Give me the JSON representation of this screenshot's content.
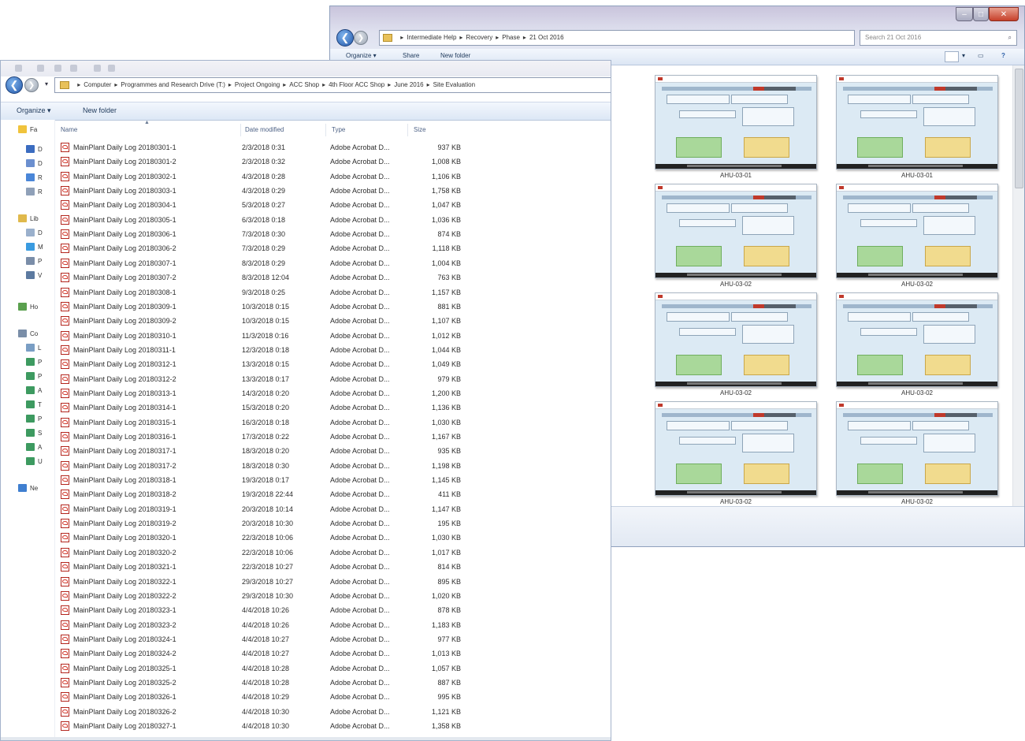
{
  "back_window": {
    "address_crumbs": [
      "▸",
      "Intermediate Help",
      "▸",
      "Recovery",
      "▸",
      "Phase",
      "▸",
      "21 Oct 2016"
    ],
    "search_placeholder": "Search 21 Oct 2016",
    "toolbar": {
      "organize": "Organize ▾",
      "share": "Share",
      "new_folder": "New folder"
    },
    "thumbnails": [
      {
        "caption": "AHU-03-01"
      },
      {
        "caption": "AHU-03-01"
      },
      {
        "caption": "AHU-03-02"
      },
      {
        "caption": "AHU-03-02"
      },
      {
        "caption": "AHU-03-02"
      },
      {
        "caption": "AHU-03-02"
      },
      {
        "caption": "AHU-03-02"
      },
      {
        "caption": "AHU-03-02"
      }
    ]
  },
  "front_window": {
    "address_crumbs": [
      "▸",
      "Computer",
      "▸",
      "Programmes and Research Drive (T:)",
      "▸",
      "Project Ongoing",
      "▸",
      "ACC Shop",
      "▸",
      "4th Floor ACC Shop",
      "▸",
      "June 2016",
      "▸",
      "Site Evaluation"
    ],
    "toolbar": {
      "organize": "Organize ▾",
      "new_folder": "New folder"
    },
    "nav_items": [
      {
        "label": "Fa"
      },
      {
        "label": "D"
      },
      {
        "label": "D"
      },
      {
        "label": "R"
      },
      {
        "label": "R"
      },
      {
        "label": "Lib"
      },
      {
        "label": "D"
      },
      {
        "label": "M"
      },
      {
        "label": "P"
      },
      {
        "label": "V"
      },
      {
        "label": "Ho"
      },
      {
        "label": "Co"
      },
      {
        "label": "L"
      },
      {
        "label": "P"
      },
      {
        "label": "P"
      },
      {
        "label": "A"
      },
      {
        "label": "T"
      },
      {
        "label": "P"
      },
      {
        "label": "S"
      },
      {
        "label": "A"
      },
      {
        "label": "U"
      },
      {
        "label": "Ne"
      }
    ],
    "columns": {
      "name": "Name",
      "date": "Date modified",
      "type": "Type",
      "size": "Size"
    },
    "files": [
      {
        "name": "MainPlant Daily Log 20180301-1",
        "date": "2/3/2018 0:31",
        "type": "Adobe Acrobat D...",
        "size": "937 KB"
      },
      {
        "name": "MainPlant Daily Log 20180301-2",
        "date": "2/3/2018 0:32",
        "type": "Adobe Acrobat D...",
        "size": "1,008 KB"
      },
      {
        "name": "MainPlant Daily Log 20180302-1",
        "date": "4/3/2018 0:28",
        "type": "Adobe Acrobat D...",
        "size": "1,106 KB"
      },
      {
        "name": "MainPlant Daily Log 20180303-1",
        "date": "4/3/2018 0:29",
        "type": "Adobe Acrobat D...",
        "size": "1,758 KB"
      },
      {
        "name": "MainPlant Daily Log 20180304-1",
        "date": "5/3/2018 0:27",
        "type": "Adobe Acrobat D...",
        "size": "1,047 KB"
      },
      {
        "name": "MainPlant Daily Log 20180305-1",
        "date": "6/3/2018 0:18",
        "type": "Adobe Acrobat D...",
        "size": "1,036 KB"
      },
      {
        "name": "MainPlant Daily Log 20180306-1",
        "date": "7/3/2018 0:30",
        "type": "Adobe Acrobat D...",
        "size": "874 KB"
      },
      {
        "name": "MainPlant Daily Log 20180306-2",
        "date": "7/3/2018 0:29",
        "type": "Adobe Acrobat D...",
        "size": "1,118 KB"
      },
      {
        "name": "MainPlant Daily Log 20180307-1",
        "date": "8/3/2018 0:29",
        "type": "Adobe Acrobat D...",
        "size": "1,004 KB"
      },
      {
        "name": "MainPlant Daily Log 20180307-2",
        "date": "8/3/2018 12:04",
        "type": "Adobe Acrobat D...",
        "size": "763 KB"
      },
      {
        "name": "MainPlant Daily Log 20180308-1",
        "date": "9/3/2018 0:25",
        "type": "Adobe Acrobat D...",
        "size": "1,157 KB"
      },
      {
        "name": "MainPlant Daily Log 20180309-1",
        "date": "10/3/2018 0:15",
        "type": "Adobe Acrobat D...",
        "size": "881 KB"
      },
      {
        "name": "MainPlant Daily Log 20180309-2",
        "date": "10/3/2018 0:15",
        "type": "Adobe Acrobat D...",
        "size": "1,107 KB"
      },
      {
        "name": "MainPlant Daily Log 20180310-1",
        "date": "11/3/2018 0:16",
        "type": "Adobe Acrobat D...",
        "size": "1,012 KB"
      },
      {
        "name": "MainPlant Daily Log 20180311-1",
        "date": "12/3/2018 0:18",
        "type": "Adobe Acrobat D...",
        "size": "1,044 KB"
      },
      {
        "name": "MainPlant Daily Log 20180312-1",
        "date": "13/3/2018 0:15",
        "type": "Adobe Acrobat D...",
        "size": "1,049 KB"
      },
      {
        "name": "MainPlant Daily Log 20180312-2",
        "date": "13/3/2018 0:17",
        "type": "Adobe Acrobat D...",
        "size": "979 KB"
      },
      {
        "name": "MainPlant Daily Log 20180313-1",
        "date": "14/3/2018 0:20",
        "type": "Adobe Acrobat D...",
        "size": "1,200 KB"
      },
      {
        "name": "MainPlant Daily Log 20180314-1",
        "date": "15/3/2018 0:20",
        "type": "Adobe Acrobat D...",
        "size": "1,136 KB"
      },
      {
        "name": "MainPlant Daily Log 20180315-1",
        "date": "16/3/2018 0:18",
        "type": "Adobe Acrobat D...",
        "size": "1,030 KB"
      },
      {
        "name": "MainPlant Daily Log 20180316-1",
        "date": "17/3/2018 0:22",
        "type": "Adobe Acrobat D...",
        "size": "1,167 KB"
      },
      {
        "name": "MainPlant Daily Log 20180317-1",
        "date": "18/3/2018 0:20",
        "type": "Adobe Acrobat D...",
        "size": "935 KB"
      },
      {
        "name": "MainPlant Daily Log 20180317-2",
        "date": "18/3/2018 0:30",
        "type": "Adobe Acrobat D...",
        "size": "1,198 KB"
      },
      {
        "name": "MainPlant Daily Log 20180318-1",
        "date": "19/3/2018 0:17",
        "type": "Adobe Acrobat D...",
        "size": "1,145 KB"
      },
      {
        "name": "MainPlant Daily Log 20180318-2",
        "date": "19/3/2018 22:44",
        "type": "Adobe Acrobat D...",
        "size": "411 KB"
      },
      {
        "name": "MainPlant Daily Log 20180319-1",
        "date": "20/3/2018 10:14",
        "type": "Adobe Acrobat D...",
        "size": "1,147 KB"
      },
      {
        "name": "MainPlant Daily Log 20180319-2",
        "date": "20/3/2018 10:30",
        "type": "Adobe Acrobat D...",
        "size": "195 KB"
      },
      {
        "name": "MainPlant Daily Log 20180320-1",
        "date": "22/3/2018 10:06",
        "type": "Adobe Acrobat D...",
        "size": "1,030 KB"
      },
      {
        "name": "MainPlant Daily Log 20180320-2",
        "date": "22/3/2018 10:06",
        "type": "Adobe Acrobat D...",
        "size": "1,017 KB"
      },
      {
        "name": "MainPlant Daily Log 20180321-1",
        "date": "22/3/2018 10:27",
        "type": "Adobe Acrobat D...",
        "size": "814 KB"
      },
      {
        "name": "MainPlant Daily Log 20180322-1",
        "date": "29/3/2018 10:27",
        "type": "Adobe Acrobat D...",
        "size": "895 KB"
      },
      {
        "name": "MainPlant Daily Log 20180322-2",
        "date": "29/3/2018 10:30",
        "type": "Adobe Acrobat D...",
        "size": "1,020 KB"
      },
      {
        "name": "MainPlant Daily Log 20180323-1",
        "date": "4/4/2018 10:26",
        "type": "Adobe Acrobat D...",
        "size": "878 KB"
      },
      {
        "name": "MainPlant Daily Log 20180323-2",
        "date": "4/4/2018 10:26",
        "type": "Adobe Acrobat D...",
        "size": "1,183 KB"
      },
      {
        "name": "MainPlant Daily Log 20180324-1",
        "date": "4/4/2018 10:27",
        "type": "Adobe Acrobat D...",
        "size": "977 KB"
      },
      {
        "name": "MainPlant Daily Log 20180324-2",
        "date": "4/4/2018 10:27",
        "type": "Adobe Acrobat D...",
        "size": "1,013 KB"
      },
      {
        "name": "MainPlant Daily Log 20180325-1",
        "date": "4/4/2018 10:28",
        "type": "Adobe Acrobat D...",
        "size": "1,057 KB"
      },
      {
        "name": "MainPlant Daily Log 20180325-2",
        "date": "4/4/2018 10:28",
        "type": "Adobe Acrobat D...",
        "size": "887 KB"
      },
      {
        "name": "MainPlant Daily Log 20180326-1",
        "date": "4/4/2018 10:29",
        "type": "Adobe Acrobat D...",
        "size": "995 KB"
      },
      {
        "name": "MainPlant Daily Log 20180326-2",
        "date": "4/4/2018 10:30",
        "type": "Adobe Acrobat D...",
        "size": "1,121 KB"
      },
      {
        "name": "MainPlant Daily Log 20180327-1",
        "date": "4/4/2018 10:30",
        "type": "Adobe Acrobat D...",
        "size": "1,358 KB"
      }
    ]
  }
}
